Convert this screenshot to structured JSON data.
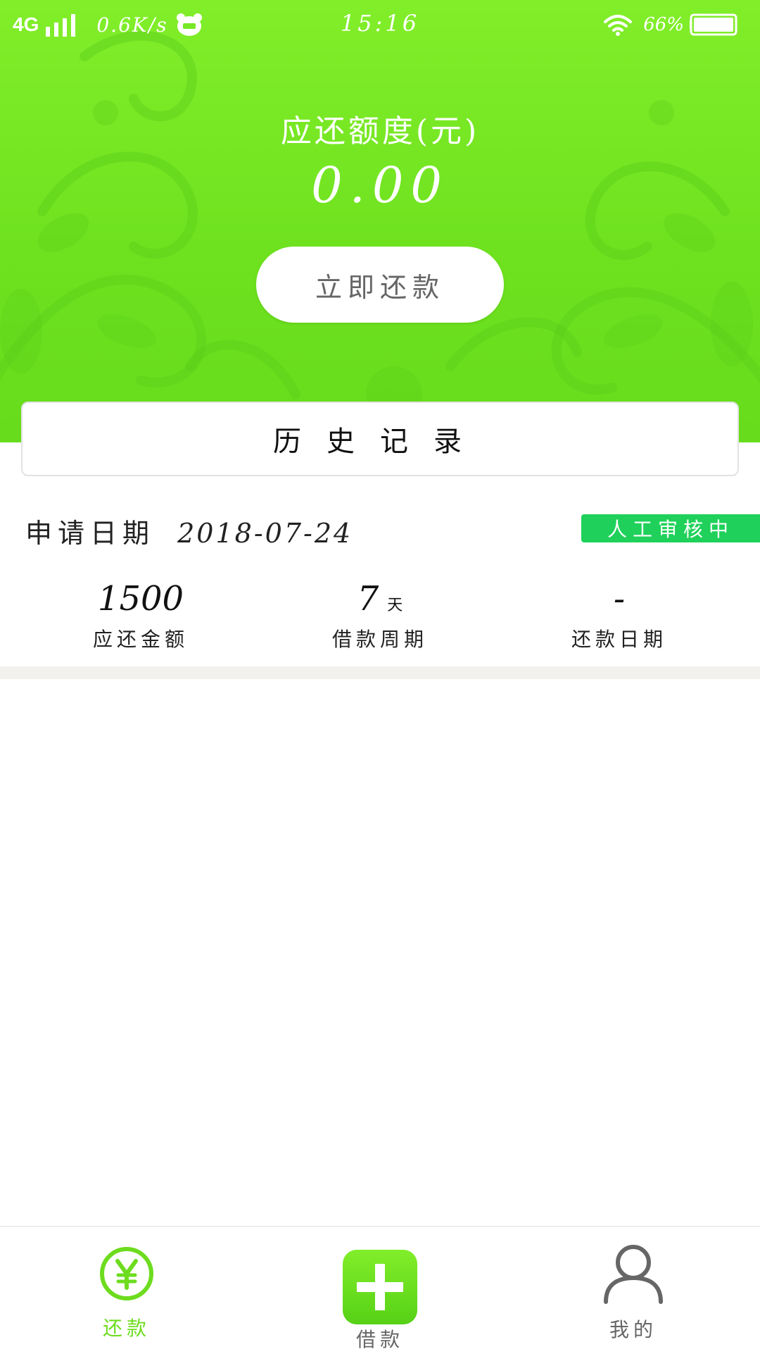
{
  "status_bar": {
    "network": "4G",
    "speed": "0.6K/s",
    "time": "15:16",
    "battery": "66%"
  },
  "summary": {
    "amount_label": "应还额度(元)",
    "amount_value": "0.00",
    "repay_button": "立即还款"
  },
  "history": {
    "title": "历史记录"
  },
  "record": {
    "apply_date_label": "申请日期",
    "apply_date_value": "2018-07-24",
    "status": "人工审核中",
    "amount_value": "1500",
    "amount_label": "应还金额",
    "period_value": "7",
    "period_unit": "天",
    "period_label": "借款周期",
    "repay_date_value": "-",
    "repay_date_label": "还款日期"
  },
  "tabs": [
    {
      "label": "还款",
      "icon": "yen-circle-icon",
      "active": true
    },
    {
      "label": "借款",
      "icon": "plus-icon",
      "active": false
    },
    {
      "label": "我的",
      "icon": "user-icon",
      "active": false
    }
  ],
  "colors": {
    "hero_green": "#77e826",
    "badge_green": "#1fd15a",
    "tab_active": "#6ddc1e",
    "tab_inactive": "#666666"
  }
}
